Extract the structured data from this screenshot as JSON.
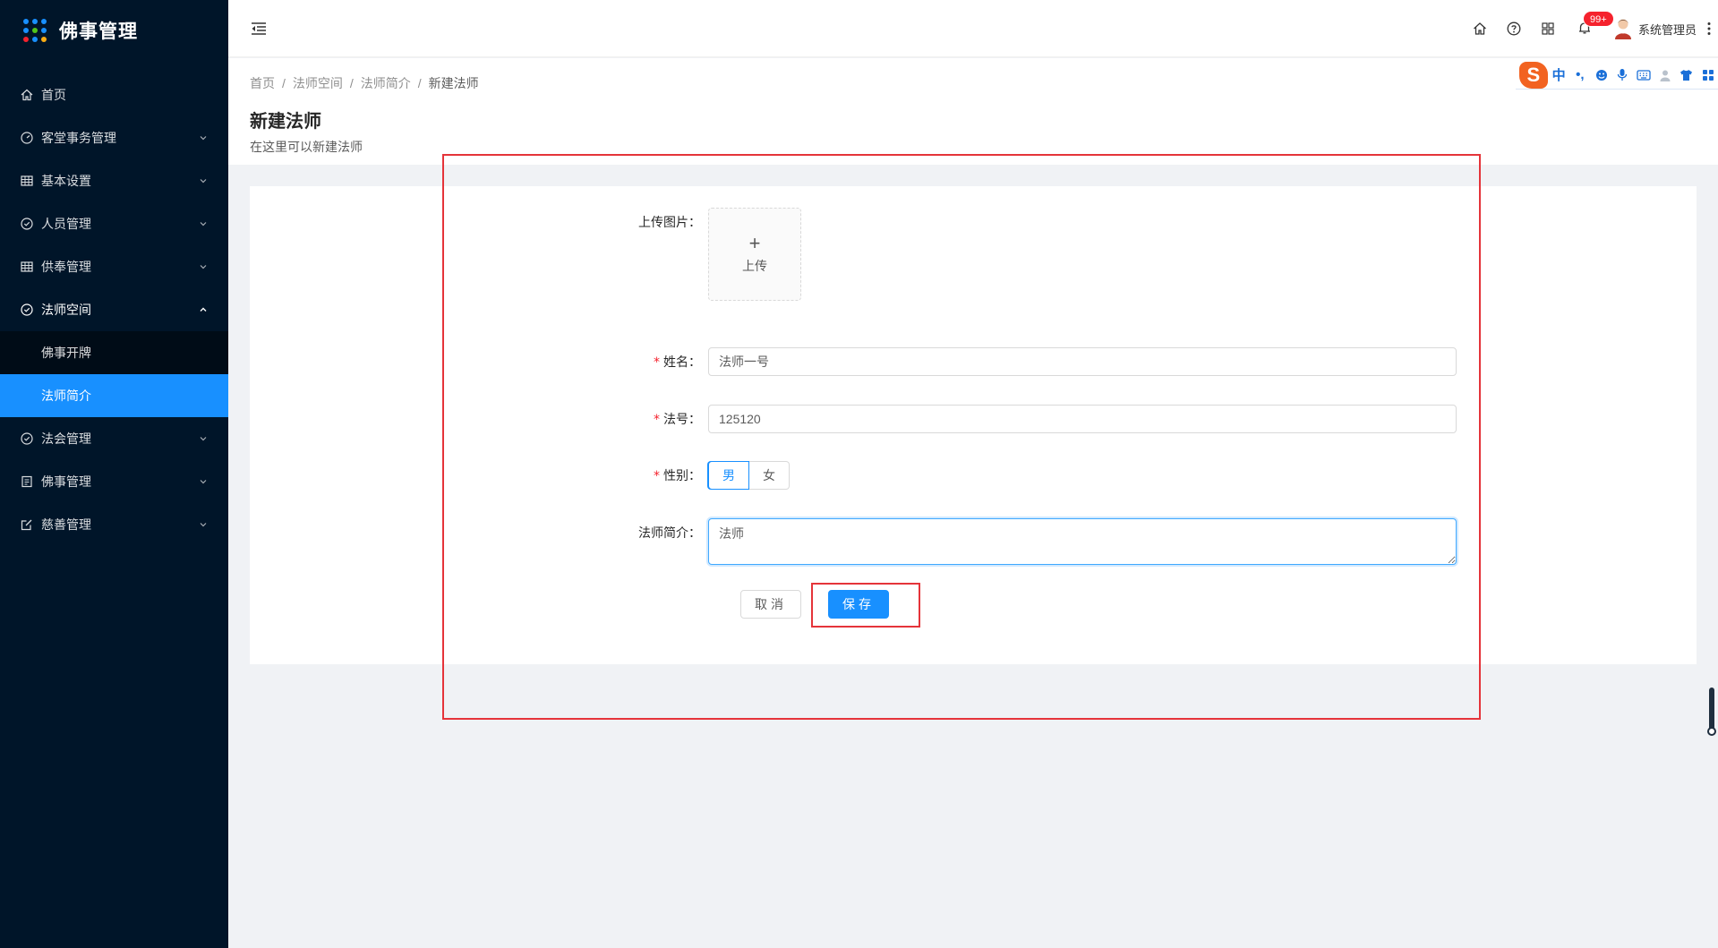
{
  "app": {
    "title": "佛事管理",
    "logo_colors": [
      "#1890ff",
      "#1890ff",
      "#1890ff",
      "#1890ff",
      "#52c41a",
      "#1890ff",
      "#f5222d",
      "#1890ff",
      "#faad14"
    ]
  },
  "sidebar": {
    "items": [
      {
        "label": "首页",
        "icon": "home-icon",
        "has_arrow": false
      },
      {
        "label": "客堂事务管理",
        "icon": "dashboard-icon",
        "has_arrow": true
      },
      {
        "label": "基本设置",
        "icon": "table-icon",
        "has_arrow": true
      },
      {
        "label": "人员管理",
        "icon": "check-circle-icon",
        "has_arrow": true
      },
      {
        "label": "供奉管理",
        "icon": "table-icon",
        "has_arrow": true
      },
      {
        "label": "法师空间",
        "icon": "check-circle-icon",
        "has_arrow": true,
        "open": true,
        "children": [
          {
            "label": "佛事开牌",
            "active": false
          },
          {
            "label": "法师简介",
            "active": true
          }
        ]
      },
      {
        "label": "法会管理",
        "icon": "check-circle-icon",
        "has_arrow": true
      },
      {
        "label": "佛事管理",
        "icon": "profile-icon",
        "has_arrow": true
      },
      {
        "label": "慈善管理",
        "icon": "form-icon",
        "has_arrow": true
      }
    ]
  },
  "header": {
    "notification_count": "99+",
    "user_name": "系统管理员",
    "icons": [
      "home-icon",
      "question-circle-icon",
      "appstore-icon",
      "bell-icon"
    ]
  },
  "ime_toolbar": {
    "logo": "S",
    "lang": "中",
    "punct": "•,",
    "buttons": [
      "emoji-icon",
      "microphone-icon",
      "keyboard-icon",
      "user-icon",
      "shirt-icon",
      "grid-icon"
    ]
  },
  "page": {
    "breadcrumb": [
      "首页",
      "法师空间",
      "法师简介",
      "新建法师"
    ],
    "title": "新建法师",
    "description": "在这里可以新建法师"
  },
  "form": {
    "upload_label": "上传图片",
    "upload_plus": "+",
    "upload_text": "上传",
    "name_label": "姓名",
    "name_value": "法师一号",
    "fahao_label": "法号",
    "fahao_value": "125120",
    "gender_label": "性别",
    "gender_options": [
      "男",
      "女"
    ],
    "gender_selected": "男",
    "intro_label": "法师简介",
    "intro_value": "法师",
    "required_mark": "*",
    "colon": "："
  },
  "actions": {
    "cancel_label": "取消",
    "save_label": "保存"
  },
  "colors": {
    "sidebar_bg": "#001529",
    "primary": "#1890ff",
    "annotation": "#e5343a",
    "badge": "#f5222d"
  }
}
